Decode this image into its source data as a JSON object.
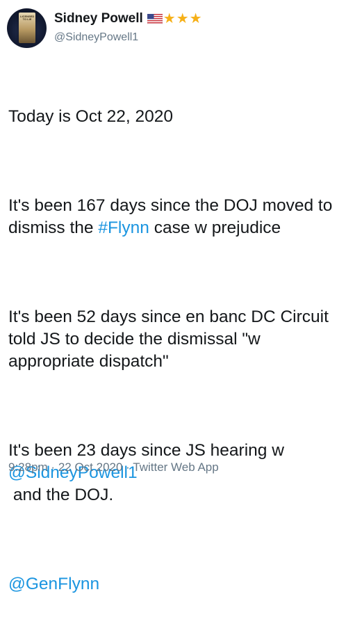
{
  "tweet": {
    "author": {
      "name": "Sidney Powell",
      "handle": "@SidneyPowell1",
      "badge_icons": [
        "us-flag-icon",
        "star-icon",
        "star-icon",
        "star-icon"
      ],
      "avatar_text": "LICENSED TO LIE"
    },
    "body": {
      "p1": "Today is Oct 22, 2020",
      "p2_a": "It's been 167 days since the DOJ moved to dismiss the ",
      "p2_link": "#Flynn",
      "p2_b": " case w prejudice",
      "p3": "It's been 52 days since en banc DC Circuit told JS to decide the dismissal \"w appropriate dispatch\"",
      "p4_a": "It's been 23 days since JS hearing w ",
      "p4_link": "@SidneyPowell1",
      "p4_b": "\n and the DOJ.",
      "p5_link": "@GenFlynn"
    },
    "meta": {
      "time": "9:28pm",
      "sep1": " · ",
      "date": "22 Oct 2020",
      "sep2": " · ",
      "source": "Twitter Web App"
    },
    "colors": {
      "link": "#1b95e0",
      "text": "#14171a",
      "secondary": "#657786",
      "star": "#f6b017"
    }
  }
}
